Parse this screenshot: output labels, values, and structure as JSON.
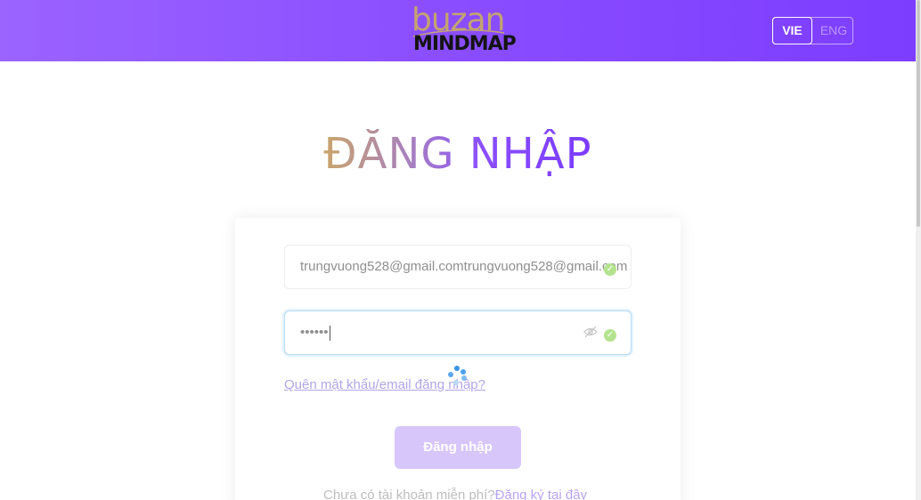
{
  "header": {
    "logo_top": "buzan",
    "logo_bottom": "MINDMAP",
    "languages": [
      {
        "label": "VIE",
        "active": true
      },
      {
        "label": "ENG",
        "active": false
      }
    ],
    "gradient": [
      "#9b63ff",
      "#7d3dff"
    ]
  },
  "login": {
    "title": "ĐĂNG NHẬP",
    "email_value": "trungvuong528@gmail.comtrungvuong528@gmail.com",
    "password_value": "••••••",
    "forgot_link": "Quên mật khẩu/email đăng nhập?",
    "submit_label": "Đăng nhập",
    "signup_prompt": "Chưa có tài khoản miễn phí?",
    "signup_link": "Đăng ký tại đây"
  },
  "icons": {
    "email_status": "check-circle-icon",
    "password_status": "check-circle-icon",
    "password_toggle": "eye-off-icon",
    "loading": "spinner-icon"
  },
  "colors": {
    "accent": "#8a4dff",
    "gold": "#c9a56a",
    "valid": "#b4e38f",
    "button_disabled": "#d7c6fa"
  }
}
